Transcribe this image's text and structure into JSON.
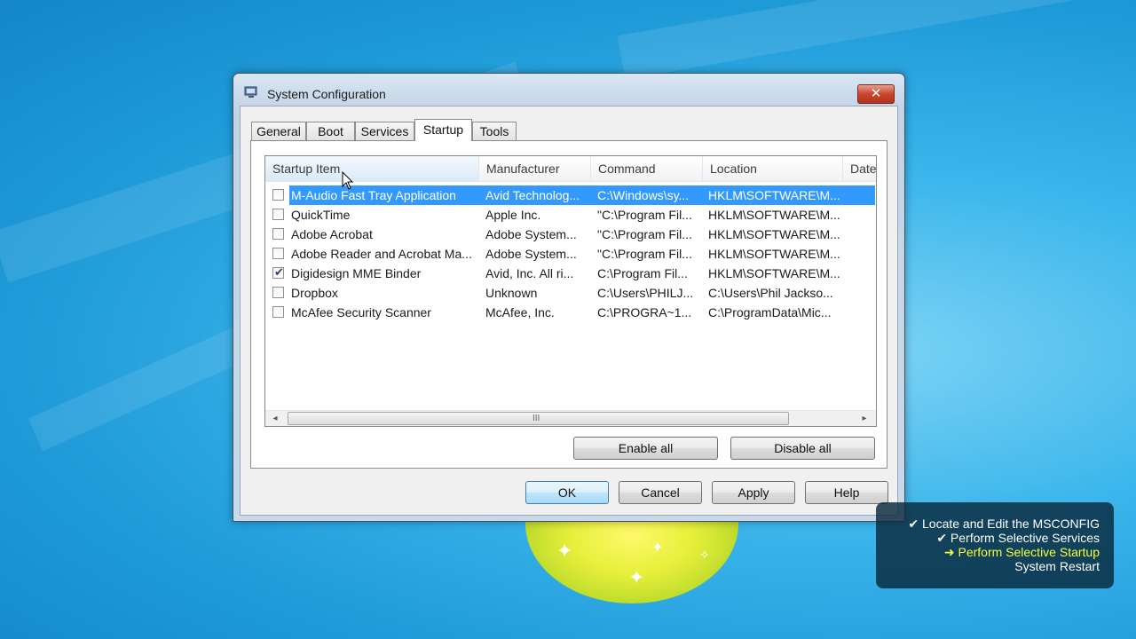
{
  "window": {
    "title": "System Configuration",
    "close_symbol": "✕"
  },
  "tabs": [
    {
      "label": "General",
      "active": false
    },
    {
      "label": "Boot",
      "active": false
    },
    {
      "label": "Services",
      "active": false
    },
    {
      "label": "Startup",
      "active": true
    },
    {
      "label": "Tools",
      "active": false
    }
  ],
  "startup_list": {
    "columns": [
      "Startup Item",
      "Manufacturer",
      "Command",
      "Location",
      "Date"
    ],
    "rows": [
      {
        "checked": false,
        "selected": true,
        "item": "M-Audio Fast Tray Application",
        "manufacturer": "Avid Technolog...",
        "command": "C:\\Windows\\sy...",
        "location": "HKLM\\SOFTWARE\\M..."
      },
      {
        "checked": false,
        "selected": false,
        "item": "QuickTime",
        "manufacturer": "Apple Inc.",
        "command": "\"C:\\Program Fil...",
        "location": "HKLM\\SOFTWARE\\M..."
      },
      {
        "checked": false,
        "selected": false,
        "item": "Adobe Acrobat",
        "manufacturer": "Adobe System...",
        "command": "\"C:\\Program Fil...",
        "location": "HKLM\\SOFTWARE\\M..."
      },
      {
        "checked": false,
        "selected": false,
        "item": "Adobe Reader and Acrobat Ma...",
        "manufacturer": "Adobe System...",
        "command": "\"C:\\Program Fil...",
        "location": "HKLM\\SOFTWARE\\M..."
      },
      {
        "checked": true,
        "selected": false,
        "item": "Digidesign MME Binder",
        "manufacturer": "Avid, Inc. All ri...",
        "command": "C:\\Program Fil...",
        "location": "HKLM\\SOFTWARE\\M..."
      },
      {
        "checked": false,
        "selected": false,
        "item": "Dropbox",
        "manufacturer": "Unknown",
        "command": "C:\\Users\\PHILJ...",
        "location": "C:\\Users\\Phil Jackso..."
      },
      {
        "checked": false,
        "selected": false,
        "item": "McAfee Security Scanner",
        "manufacturer": "McAfee, Inc.",
        "command": "C:\\PROGRA~1...",
        "location": "C:\\ProgramData\\Mic..."
      }
    ],
    "scroll_left": "◂",
    "scroll_right": "▸",
    "scroll_grip": "III"
  },
  "buttons": {
    "enable_all": "Enable all",
    "disable_all": "Disable all",
    "ok": "OK",
    "cancel": "Cancel",
    "apply": "Apply",
    "help": "Help"
  },
  "overlay": {
    "steps": [
      {
        "text": "✔ Locate and Edit the MSCONFIG",
        "state": "done"
      },
      {
        "text": "✔ Perform Selective Services",
        "state": "done"
      },
      {
        "text": "➜ Perform Selective Startup",
        "state": "current"
      },
      {
        "text": "System Restart",
        "state": "pending"
      }
    ]
  },
  "colors": {
    "selection": "#3399ff",
    "overlay_highlight": "#f5ff3a"
  }
}
